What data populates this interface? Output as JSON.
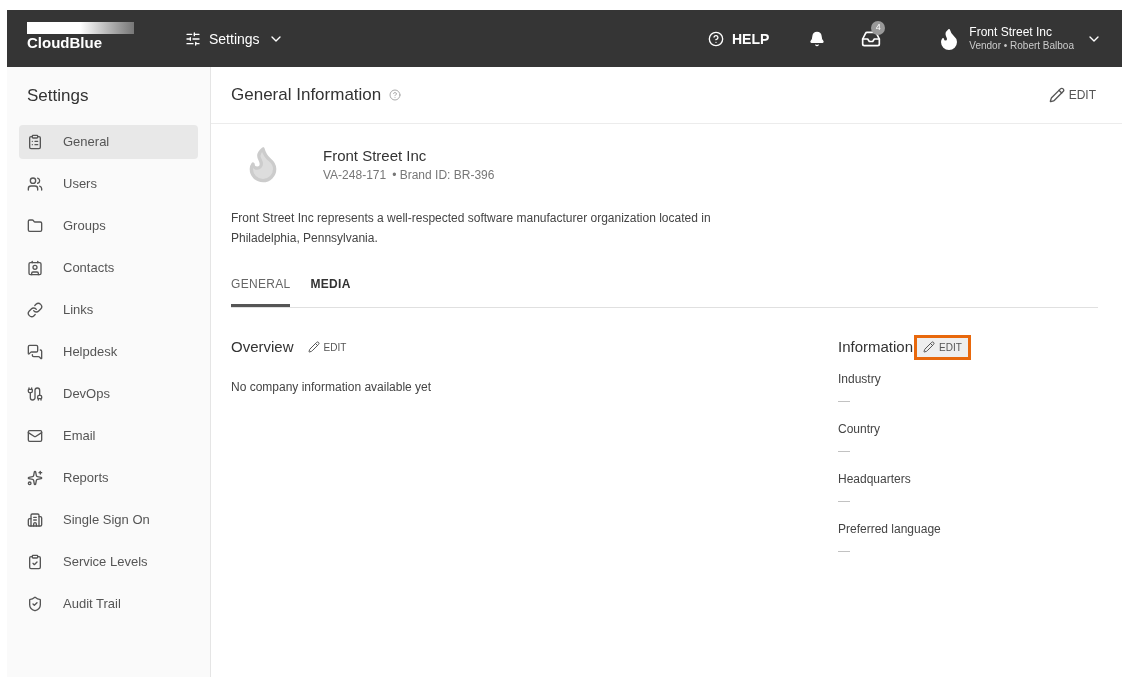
{
  "header": {
    "logo": "CloudBlue",
    "menu": "Settings",
    "help": "HELP",
    "inbox_count": "4",
    "account": {
      "name": "Front Street Inc",
      "role": "Vendor • Robert Balboa"
    }
  },
  "sidebar": {
    "title": "Settings",
    "items": [
      {
        "label": "General",
        "selected": true
      },
      {
        "label": "Users",
        "selected": false
      },
      {
        "label": "Groups",
        "selected": false
      },
      {
        "label": "Contacts",
        "selected": false
      },
      {
        "label": "Links",
        "selected": false
      },
      {
        "label": "Helpdesk",
        "selected": false
      },
      {
        "label": "DevOps",
        "selected": false
      },
      {
        "label": "Email",
        "selected": false
      },
      {
        "label": "Reports",
        "selected": false
      },
      {
        "label": "Single Sign On",
        "selected": false
      },
      {
        "label": "Service Levels",
        "selected": false
      },
      {
        "label": "Audit Trail",
        "selected": false
      }
    ]
  },
  "page": {
    "title": "General Information",
    "edit": "EDIT"
  },
  "company": {
    "name": "Front Street Inc",
    "id": "VA-248-171",
    "brand": "• Brand ID: BR-396",
    "description": "Front Street Inc represents a well-respected software manufacturer organization located in Philadelphia, Pennsylvania."
  },
  "tabs": [
    {
      "label": "GENERAL",
      "selected": true
    },
    {
      "label": "MEDIA",
      "selected": false
    }
  ],
  "overview": {
    "title": "Overview",
    "edit": "EDIT",
    "text": "No company information available yet"
  },
  "information": {
    "title": "Information",
    "edit": "EDIT",
    "highlighted": true,
    "fields": [
      {
        "label": "Industry",
        "value": "—"
      },
      {
        "label": "Country",
        "value": "—"
      },
      {
        "label": "Headquarters",
        "value": "—"
      },
      {
        "label": "Preferred language",
        "value": "—"
      }
    ]
  }
}
